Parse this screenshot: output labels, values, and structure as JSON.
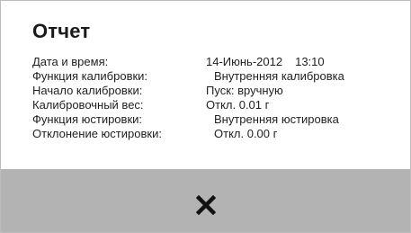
{
  "report": {
    "title": "Отчет",
    "fields": [
      {
        "label": "Дата и время:",
        "value": "14-Июнь-2012",
        "time": "13:10"
      },
      {
        "label": "Функция калибровки:",
        "value": "Внутренняя калибровка"
      },
      {
        "label": "Начало калибровки:",
        "value": "Пуск: вручную"
      },
      {
        "label": "Калибровочный вес:",
        "value": "Откл. 0.01 г"
      },
      {
        "label": "Функция юстировки:",
        "value": "Внутренняя юстировка"
      },
      {
        "label": "Отклонение юстировки:",
        "value": "Откл. 0.00 г"
      }
    ]
  },
  "footer": {
    "close_icon": "close-icon",
    "background": "#b3b3b3"
  }
}
